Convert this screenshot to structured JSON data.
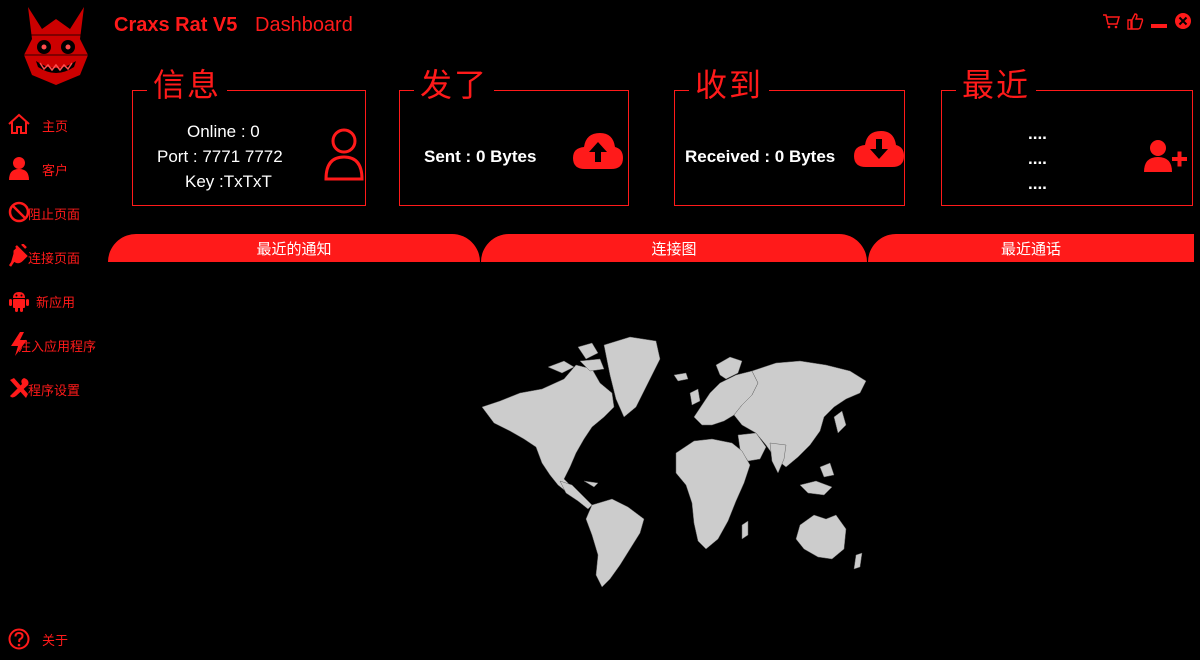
{
  "app": {
    "title": "Craxs Rat V5",
    "page": "Dashboard"
  },
  "window_controls": [
    "cart-icon",
    "thumbs-up-icon",
    "minimize-icon",
    "close-icon"
  ],
  "sidebar": {
    "items": [
      {
        "label": "主页",
        "icon": "home-icon"
      },
      {
        "label": "客户",
        "icon": "user-icon"
      },
      {
        "label": "阻止页面",
        "icon": "block-icon"
      },
      {
        "label": "连接页面",
        "icon": "plug-icon"
      },
      {
        "label": "新应用",
        "icon": "android-icon"
      },
      {
        "label": "注入应用程序",
        "icon": "lightning-icon"
      },
      {
        "label": "程序设置",
        "icon": "tools-icon"
      }
    ],
    "about": {
      "label": "关于",
      "icon": "help-icon"
    }
  },
  "cards": {
    "info": {
      "title": "信息",
      "online": "Online : 0",
      "port": "Port : 7771 7772",
      "key": "Key :TxTxT",
      "icon": "user-outline-icon"
    },
    "sent": {
      "title": "发了",
      "text": "Sent : 0 Bytes",
      "icon": "cloud-upload-icon"
    },
    "received": {
      "title": "收到",
      "text": "Received : 0 Bytes",
      "icon": "cloud-download-icon"
    },
    "recent": {
      "title": "最近",
      "lines": [
        "....",
        "....",
        "...."
      ],
      "icon": "user-add-icon"
    }
  },
  "tabs": [
    "最近的通知",
    "连接图",
    "最近通话"
  ],
  "colors": {
    "accent": "#ff1a1a",
    "background": "#000000",
    "map_land": "#cccccc"
  }
}
